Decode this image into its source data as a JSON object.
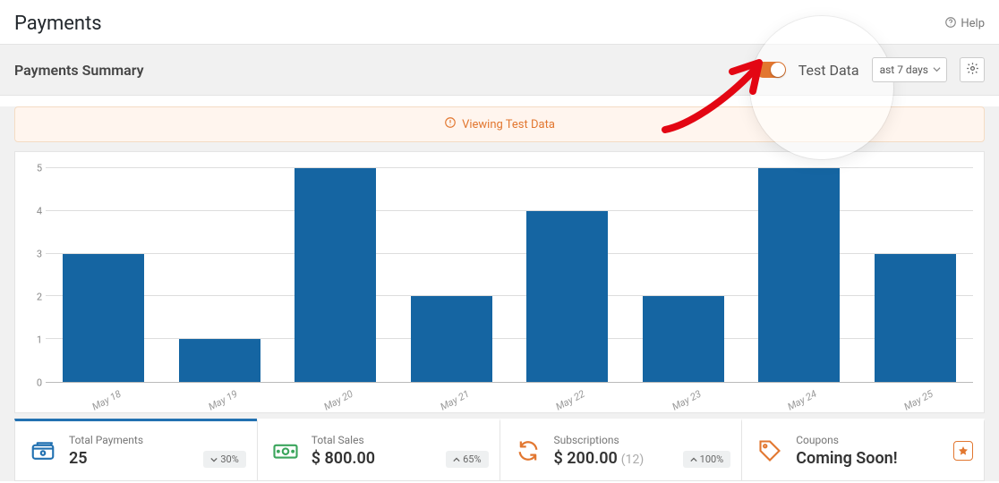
{
  "header": {
    "title": "Payments",
    "help": "Help"
  },
  "summary": {
    "title": "Payments Summary",
    "toggle_label": "Test Data",
    "range_selected": "ast 7 days"
  },
  "banner": {
    "text": "Viewing Test Data"
  },
  "chart_data": {
    "type": "bar",
    "categories": [
      "May 18",
      "May 19",
      "May 20",
      "May 21",
      "May 22",
      "May 23",
      "May 24",
      "May 25"
    ],
    "values": [
      3,
      1,
      5,
      2,
      4,
      2,
      5,
      3
    ],
    "title": "",
    "xlabel": "",
    "ylabel": "",
    "ylim": [
      0,
      5
    ],
    "yticks": [
      0,
      1,
      2,
      3,
      4,
      5
    ]
  },
  "stats": {
    "total_payments": {
      "label": "Total Payments",
      "value": "25",
      "delta": "30%",
      "delta_dir": "down"
    },
    "total_sales": {
      "label": "Total Sales",
      "value": "$ 800.00",
      "delta": "65%",
      "delta_dir": "up"
    },
    "subscriptions": {
      "label": "Subscriptions",
      "value": "$ 200.00",
      "count": "(12)",
      "delta": "100%",
      "delta_dir": "up"
    },
    "coupons": {
      "label": "Coupons",
      "value": "Coming Soon!"
    }
  }
}
